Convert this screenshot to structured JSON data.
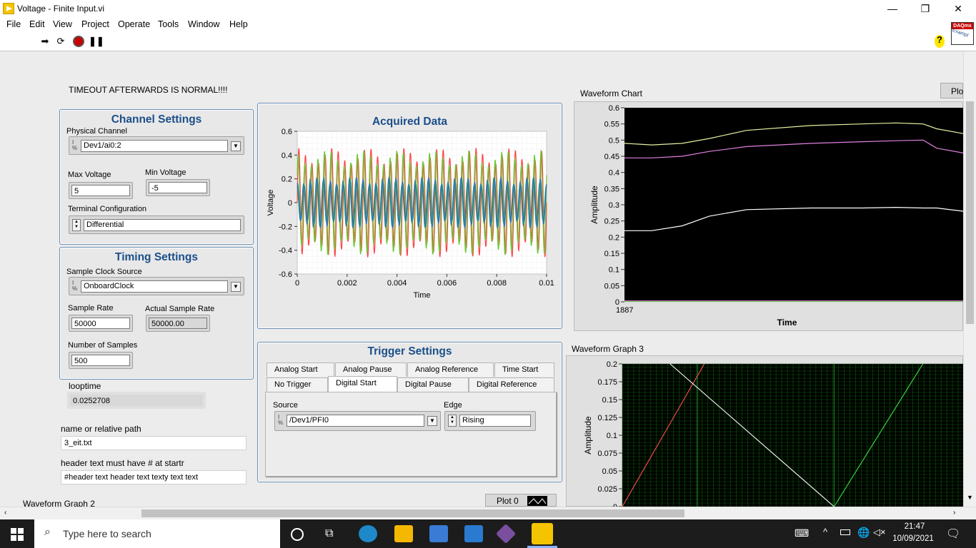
{
  "window": {
    "title": "Voltage - Finite Input.vi",
    "minimize": "—",
    "restore": "❐",
    "close": "✕"
  },
  "menu": [
    "File",
    "Edit",
    "View",
    "Project",
    "Operate",
    "Tools",
    "Window",
    "Help"
  ],
  "toolbar": {
    "help_glyph": "?",
    "daqmx_badge": "DAQmx",
    "daqmx_sub": "Exampl"
  },
  "note": "TIMEOUT AFTERWARDS IS NORMAL!!!!",
  "channel_settings": {
    "title": "Channel Settings",
    "physical_channel_label": "Physical Channel",
    "physical_channel": "Dev1/ai0:2",
    "max_voltage_label": "Max Voltage",
    "max_voltage": "5",
    "min_voltage_label": "Min Voltage",
    "min_voltage": "-5",
    "terminal_config_label": "Terminal Configuration",
    "terminal_config": "Differential"
  },
  "timing_settings": {
    "title": "Timing Settings",
    "clock_source_label": "Sample Clock Source",
    "clock_source": "OnboardClock",
    "sample_rate_label": "Sample Rate",
    "sample_rate": "50000",
    "actual_rate_label": "Actual Sample Rate",
    "actual_rate": "50000.00",
    "num_samples_label": "Number of Samples",
    "num_samples": "500"
  },
  "looptime": {
    "label": "looptime",
    "value": "0.0252708"
  },
  "path": {
    "label": "name or relative path",
    "value": "3_eit.txt"
  },
  "header": {
    "label": "header text must have # at startr",
    "value": "#header text header text texty text text"
  },
  "waveform_graph2_label": "Waveform Graph 2",
  "plot0_label": "Plot 0",
  "trigger": {
    "title": "Trigger Settings",
    "tabs_row1": [
      "Analog Start",
      "Analog Pause",
      "Analog Reference",
      "Time Start"
    ],
    "tabs_row2": [
      "No Trigger",
      "Digital Start",
      "Digital Pause",
      "Digital Reference"
    ],
    "selected_tab": "Digital Start",
    "source_label": "Source",
    "source": "/Dev1/PFI0",
    "edge_label": "Edge",
    "edge": "Rising"
  },
  "colors": {
    "accent_title": "#1b4f8a",
    "plot_red": "#ff4040",
    "plot_green": "#66cc33",
    "plot_blue": "#3366cc",
    "plot_teal": "#2a8a8a"
  },
  "chart_data": [
    {
      "type": "line",
      "title": "Acquired Data",
      "xlabel": "Time",
      "ylabel": "Voltage",
      "xlim": [
        0,
        0.01
      ],
      "ylim": [
        -0.6,
        0.6
      ],
      "x_ticks": [
        "0",
        "0.002",
        "0.004",
        "0.006",
        "0.008",
        "0.01"
      ],
      "y_ticks": [
        "0.6",
        "0.4",
        "0.2",
        "0",
        "-0.2",
        "-0.4",
        "-0.6"
      ],
      "grid": true,
      "series": [
        {
          "color": "#ff4040",
          "amplitude": 0.46,
          "cycles": 38
        },
        {
          "color": "#66cc33",
          "amplitude": 0.44,
          "cycles": 38
        },
        {
          "color": "#3366cc",
          "amplitude": 0.21,
          "cycles": 38
        },
        {
          "color": "#2a8a8a",
          "amplitude": 0.21,
          "cycles": 38
        }
      ]
    },
    {
      "type": "line",
      "title": "Waveform Chart",
      "xlabel": "Time",
      "ylabel": "Amplitude",
      "ylim": [
        0,
        0.6
      ],
      "x_ticks": [
        "1887"
      ],
      "y_ticks": [
        "0.6",
        "0.55",
        "0.5",
        "0.45",
        "0.4",
        "0.35",
        "0.3",
        "0.25",
        "0.2",
        "0.15",
        "0.1",
        "0.05",
        "0"
      ],
      "plot_legend_label": "Plo",
      "series": [
        {
          "color": "#e8f0a0",
          "x": [
            0,
            0.08,
            0.17,
            0.25,
            0.36,
            0.55,
            0.7,
            0.8,
            0.88,
            0.92,
            1
          ],
          "y": [
            0.49,
            0.485,
            0.49,
            0.505,
            0.53,
            0.545,
            0.55,
            0.553,
            0.55,
            0.535,
            0.52
          ]
        },
        {
          "color": "#e080e0",
          "x": [
            0,
            0.08,
            0.17,
            0.25,
            0.36,
            0.55,
            0.7,
            0.8,
            0.88,
            0.92,
            1
          ],
          "y": [
            0.445,
            0.445,
            0.45,
            0.465,
            0.48,
            0.49,
            0.495,
            0.498,
            0.5,
            0.475,
            0.46
          ]
        },
        {
          "color": "#ffffff",
          "x": [
            0,
            0.08,
            0.17,
            0.25,
            0.36,
            0.55,
            0.7,
            0.8,
            0.88,
            0.92,
            1
          ],
          "y": [
            0.22,
            0.22,
            0.235,
            0.265,
            0.285,
            0.29,
            0.29,
            0.292,
            0.29,
            0.29,
            0.28
          ]
        },
        {
          "color": "#e060c0",
          "x": [
            0,
            1
          ],
          "y": [
            0.003,
            0.003
          ]
        },
        {
          "color": "#60c060",
          "x": [
            0,
            1
          ],
          "y": [
            0.001,
            0.001
          ]
        }
      ]
    },
    {
      "type": "line",
      "title": "Waveform Graph 3",
      "ylabel": "Amplitude",
      "ylim": [
        0,
        0.2
      ],
      "y_ticks": [
        "0.2",
        "0.175",
        "0.15",
        "0.125",
        "0.1",
        "0.075",
        "0.05",
        "0.025",
        "0"
      ],
      "grid": true,
      "series": [
        {
          "color": "#ff5050",
          "x": [
            0,
            0.24
          ],
          "y": [
            0,
            0.2
          ]
        },
        {
          "color": "#ffffff",
          "x": [
            0.14,
            0.62
          ],
          "y": [
            0.2,
            0
          ]
        },
        {
          "color": "#40e040",
          "x": [
            0.62,
            0.88
          ],
          "y": [
            0,
            0.2
          ]
        }
      ]
    }
  ],
  "taskbar": {
    "search_placeholder": "Type here to search",
    "time": "21:47",
    "date": "10/09/2021"
  }
}
